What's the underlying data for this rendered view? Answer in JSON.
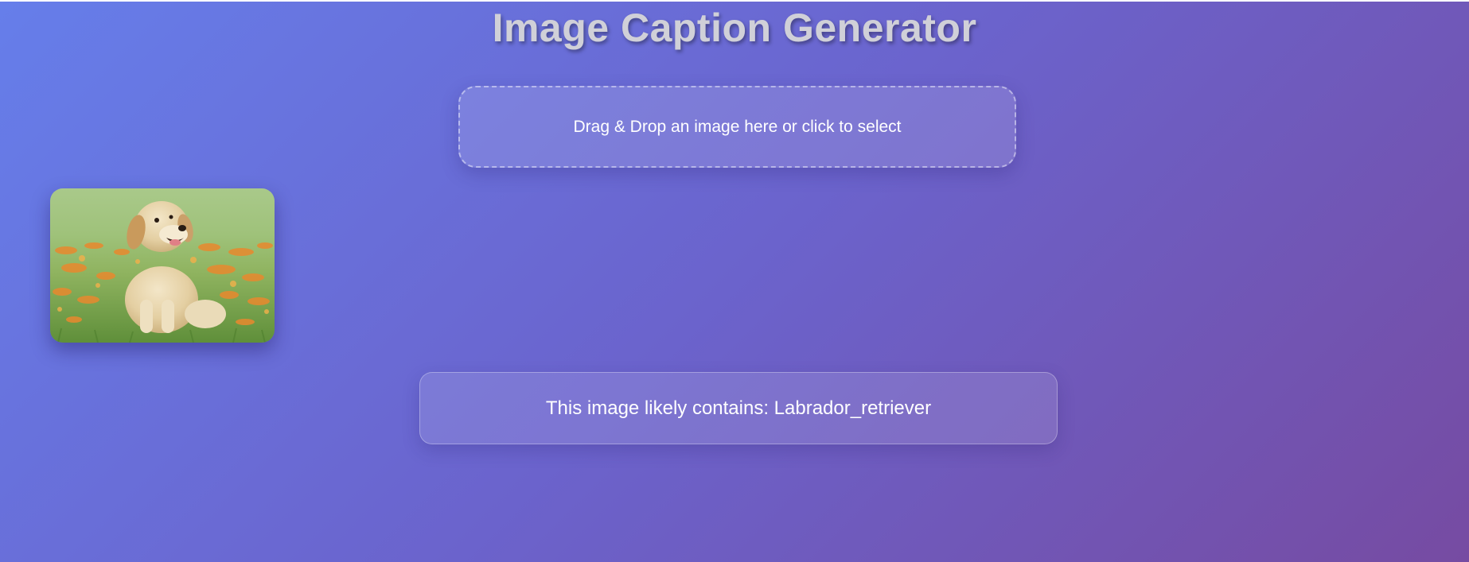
{
  "header": {
    "title": "Image Caption Generator"
  },
  "upload": {
    "prompt": "Drag & Drop an image here or click to select"
  },
  "preview": {
    "subject": "puppy sitting in grass with orange flowers"
  },
  "result": {
    "caption": "This image likely contains: Labrador_retriever"
  },
  "colors": {
    "gradient_start": "#667eea",
    "gradient_end": "#764ba2",
    "text": "#ffffff",
    "title": "#d0d0d8"
  }
}
